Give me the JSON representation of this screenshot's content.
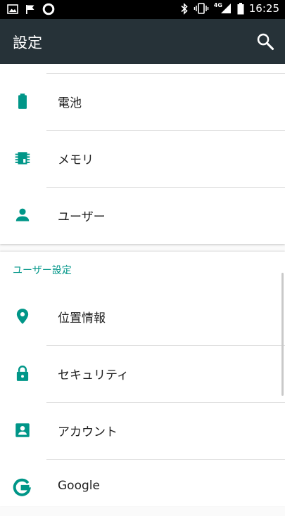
{
  "status_bar": {
    "time": "16:25",
    "network": "4G",
    "left_icons": [
      "image-icon",
      "flag-icon",
      "circle-icon"
    ],
    "right_icons": [
      "bluetooth-icon",
      "vibrate-icon",
      "signal-icon",
      "battery-icon"
    ]
  },
  "app_bar": {
    "title": "設定",
    "action_icon": "search-icon"
  },
  "top_card": {
    "items": [
      {
        "label": "電池",
        "icon": "battery-icon"
      },
      {
        "label": "メモリ",
        "icon": "memory-icon"
      },
      {
        "label": "ユーザー",
        "icon": "person-icon"
      }
    ]
  },
  "user_settings": {
    "header": "ユーザー設定",
    "items": [
      {
        "label": "位置情報",
        "icon": "location-icon"
      },
      {
        "label": "セキュリティ",
        "icon": "lock-icon"
      },
      {
        "label": "アカウント",
        "icon": "account-box-icon"
      },
      {
        "label": "Google",
        "icon": "google-icon"
      }
    ]
  },
  "colors": {
    "accent": "#009688",
    "app_bar": "#263238",
    "status_bar": "#000000"
  }
}
